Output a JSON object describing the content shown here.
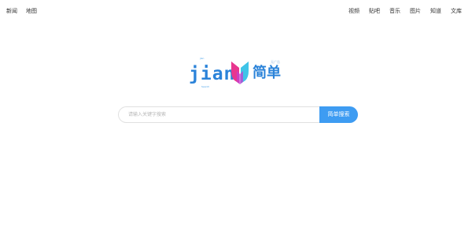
{
  "nav": {
    "left": [
      {
        "label": "新闻"
      },
      {
        "label": "地图"
      }
    ],
    "right": [
      {
        "label": "视频"
      },
      {
        "label": "贴吧"
      },
      {
        "label": "音乐"
      },
      {
        "label": "图片"
      },
      {
        "label": "知道"
      },
      {
        "label": "文库"
      }
    ]
  },
  "logo": {
    "brand_text": "jian",
    "cn_text": "简单",
    "small_top": "jian",
    "small_bottom": "Search",
    "small_tag": "无广告",
    "colors": {
      "blue": "#2b83d9",
      "pink": "#e8368f",
      "teal": "#3fc4e8"
    }
  },
  "search": {
    "placeholder": "请输入关键字搜索",
    "value": "",
    "button_label": "简单搜索",
    "button_color": "#3e9cf2"
  }
}
